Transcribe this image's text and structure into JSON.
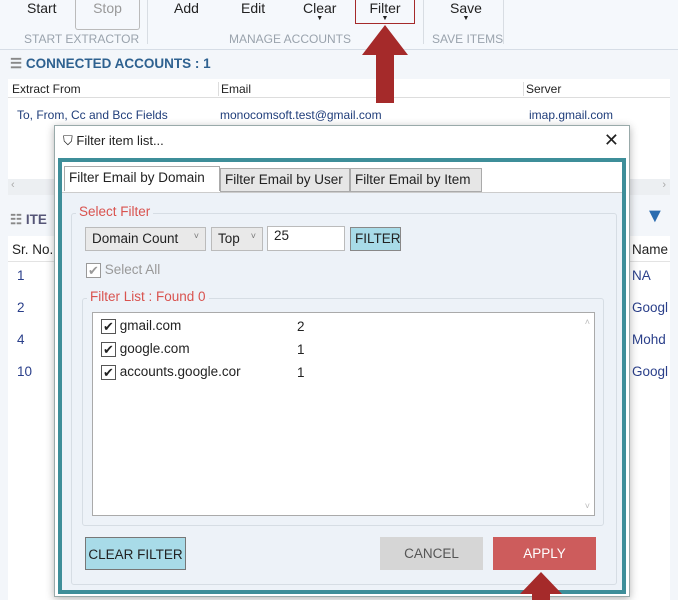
{
  "toolbar": {
    "start": "Start",
    "stop": "Stop",
    "add": "Add",
    "edit": "Edit",
    "clear": "Clear",
    "filter": "Filter",
    "save": "Save",
    "groups": [
      "START EXTRACTOR",
      "MANAGE ACCOUNTS",
      "SAVE ITEMS"
    ]
  },
  "accounts": {
    "title": "CONNECTED ACCOUNTS : 1",
    "columns": [
      "Extract From",
      "Email",
      "Server"
    ],
    "rows": [
      [
        "To, From, Cc and Bcc Fields",
        "monocomsoft.test@gmail.com",
        "imap.gmail.com"
      ]
    ]
  },
  "items": {
    "title": "ITE",
    "col_sr": "Sr. No.",
    "col_name": "Name",
    "rows": [
      {
        "sr": "1",
        "name": "NA"
      },
      {
        "sr": "2",
        "name": "Googl"
      },
      {
        "sr": "4",
        "name": "Mohd"
      },
      {
        "sr": "10",
        "name": "Googl"
      }
    ]
  },
  "dialog": {
    "title": "Filter item list...",
    "tabs": [
      "Filter Email by Domain",
      "Filter Email by User",
      "Filter Email by Item"
    ],
    "select_filter": "Select Filter",
    "filter_type": "Domain Count",
    "order": "Top",
    "count": "25",
    "filter_btn": "FILTER",
    "select_all": "Select All",
    "filter_list": "Filter List : Found 0",
    "list": [
      {
        "domain": "gmail.com",
        "count": "2",
        "checked": true
      },
      {
        "domain": "google.com",
        "count": "1",
        "checked": true
      },
      {
        "domain": "accounts.google.cor",
        "count": "1",
        "checked": true
      }
    ],
    "clear_filter": "CLEAR FILTER",
    "cancel": "CANCEL",
    "apply": "APPLY"
  },
  "colors": {
    "accent": "#2e6190",
    "teal": "#3e8e99",
    "apply": "#cd5c5c",
    "filter_btn": "#a8dbe8",
    "arrow": "#a52a2a"
  }
}
